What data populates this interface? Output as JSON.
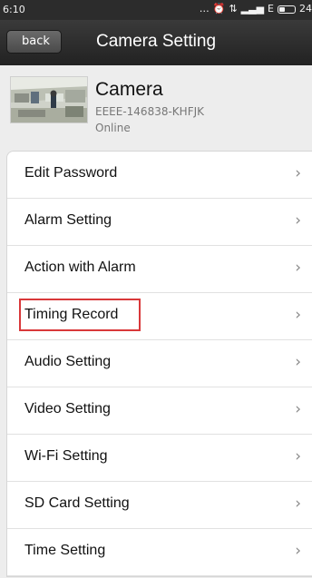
{
  "status_bar": {
    "time": "6:10",
    "icons": [
      "more-icon",
      "alarm-icon",
      "data-arrows-icon",
      "signal-icon",
      "network-type-icon",
      "battery-icon"
    ],
    "glyphs": [
      "…",
      "⏰",
      "⇅",
      "▂▃▅",
      "E"
    ],
    "battery_text": "24",
    "battery_level": 0.4
  },
  "nav": {
    "back_label": "back",
    "title": "Camera Setting"
  },
  "device": {
    "name": "Camera",
    "id": "EEEE-146838-KHFJK",
    "status": "Online"
  },
  "settings": {
    "items": [
      {
        "label": "Edit Password",
        "name": "edit-password"
      },
      {
        "label": "Alarm Setting",
        "name": "alarm-setting"
      },
      {
        "label": "Action with Alarm",
        "name": "action-with-alarm"
      },
      {
        "label": "Timing Record",
        "name": "timing-record",
        "highlighted": true
      },
      {
        "label": "Audio Setting",
        "name": "audio-setting"
      },
      {
        "label": "Video Setting",
        "name": "video-setting"
      },
      {
        "label": "Wi-Fi Setting",
        "name": "wifi-setting"
      },
      {
        "label": "SD Card Setting",
        "name": "sd-card-setting"
      },
      {
        "label": "Time Setting",
        "name": "time-setting"
      }
    ],
    "chevron": "›"
  },
  "colors": {
    "nav_background": "#2a2a2a",
    "page_background": "#ededed",
    "highlight": "#d9383a"
  }
}
